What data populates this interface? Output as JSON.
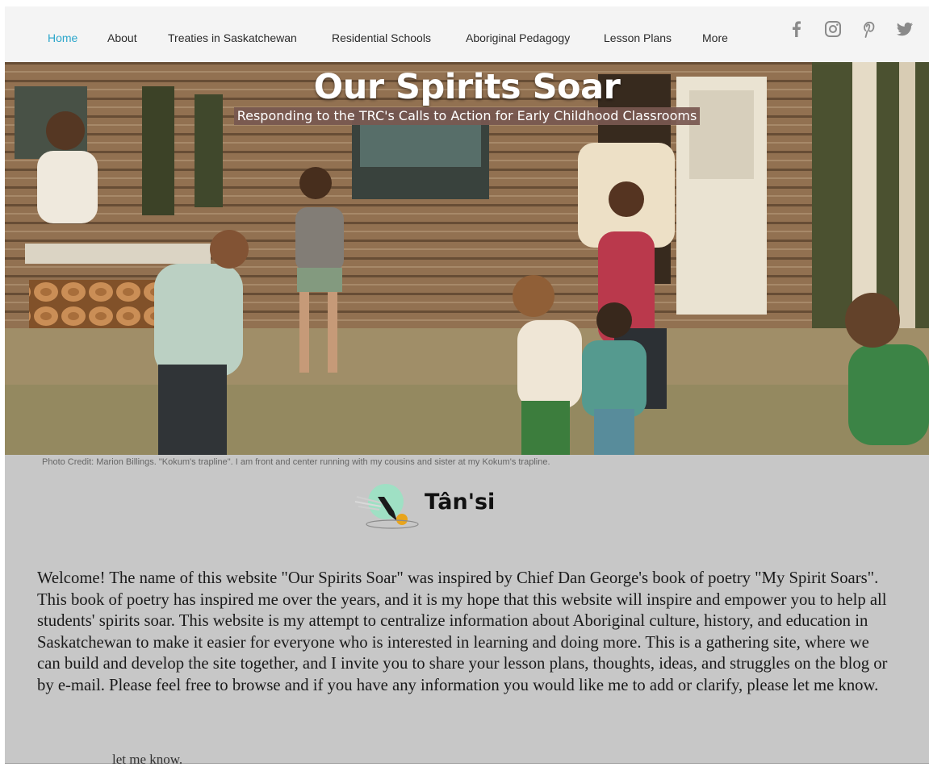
{
  "nav": {
    "items": [
      {
        "label": "Home",
        "active": true
      },
      {
        "label": "About"
      },
      {
        "label": "Treaties in Saskatchewan"
      },
      {
        "label": "Residential Schools"
      },
      {
        "label": "Aboriginal Pedagogy"
      },
      {
        "label": "Lesson Plans"
      },
      {
        "label": "More"
      }
    ],
    "active_color": "#2ba6cb"
  },
  "social_icons": [
    "facebook-icon",
    "instagram-icon",
    "pinterest-icon",
    "twitter-icon"
  ],
  "hero": {
    "title": "Our Spirits Soar",
    "subtitle": "Responding to the TRC's Calls to Action for Early Childhood Classrooms"
  },
  "caption": "Photo Credit: Marion Billings. \"Kokum's trapline\". I am front and center running with my cousins and sister at my Kokum's trapline.",
  "greeting": "Tân'si",
  "welcome": "Welcome! The name of this website \"Our Spirits Soar\" was inspired by Chief Dan George's book of poetry \"My Spirit Soars\". This book of poetry has inspired me over the years, and it is my hope that this website will inspire and empower you to help all students' spirits soar. This website is my attempt to centralize information about Aboriginal culture, history, and education in Saskatchewan to make it easier for everyone who is interested in learning and doing more. This is a gathering site, where we can build and develop the site together, and I invite you to share your lesson plans, thoughts, ideas, and struggles on the blog or by e-mail. Please feel free to browse and if you have any information you would like me to add or clarify, please let me know.",
  "overflow_text": "let me know."
}
